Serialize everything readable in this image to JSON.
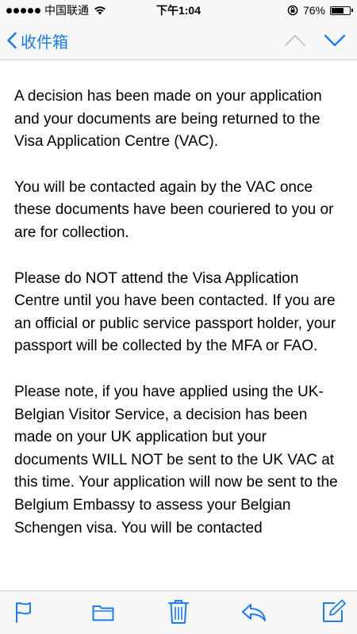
{
  "status_bar": {
    "carrier": "中国联通",
    "time": "下午1:04",
    "battery": "76%",
    "battery_level": 0.76
  },
  "nav": {
    "back_label": "收件箱",
    "accent": "#1a7cf5",
    "icons": [
      "chevron-left-icon",
      "chevron-up-icon",
      "chevron-down-icon"
    ]
  },
  "message": {
    "paragraphs": [
      "A decision has been made on your application and your documents are being returned to the Visa Application Centre (VAC).",
      "You will be contacted again by the VAC once these documents have been couriered to you or are for collection.",
      "Please do NOT attend the Visa Application Centre until you have been contacted.  If you are an official or public service passport holder, your passport will be collected by the MFA or FAO.",
      "Please note, if you have applied using the UK-Belgian Visitor Service, a decision has been made on your UK application but your documents WILL NOT be sent to the UK VAC at this time. Your application will now be sent to the Belgium Embassy to assess your Belgian Schengen visa. You will be contacted"
    ]
  },
  "toolbar": {
    "icons": [
      "flag-icon",
      "folder-icon",
      "trash-icon",
      "reply-icon",
      "compose-icon"
    ]
  }
}
